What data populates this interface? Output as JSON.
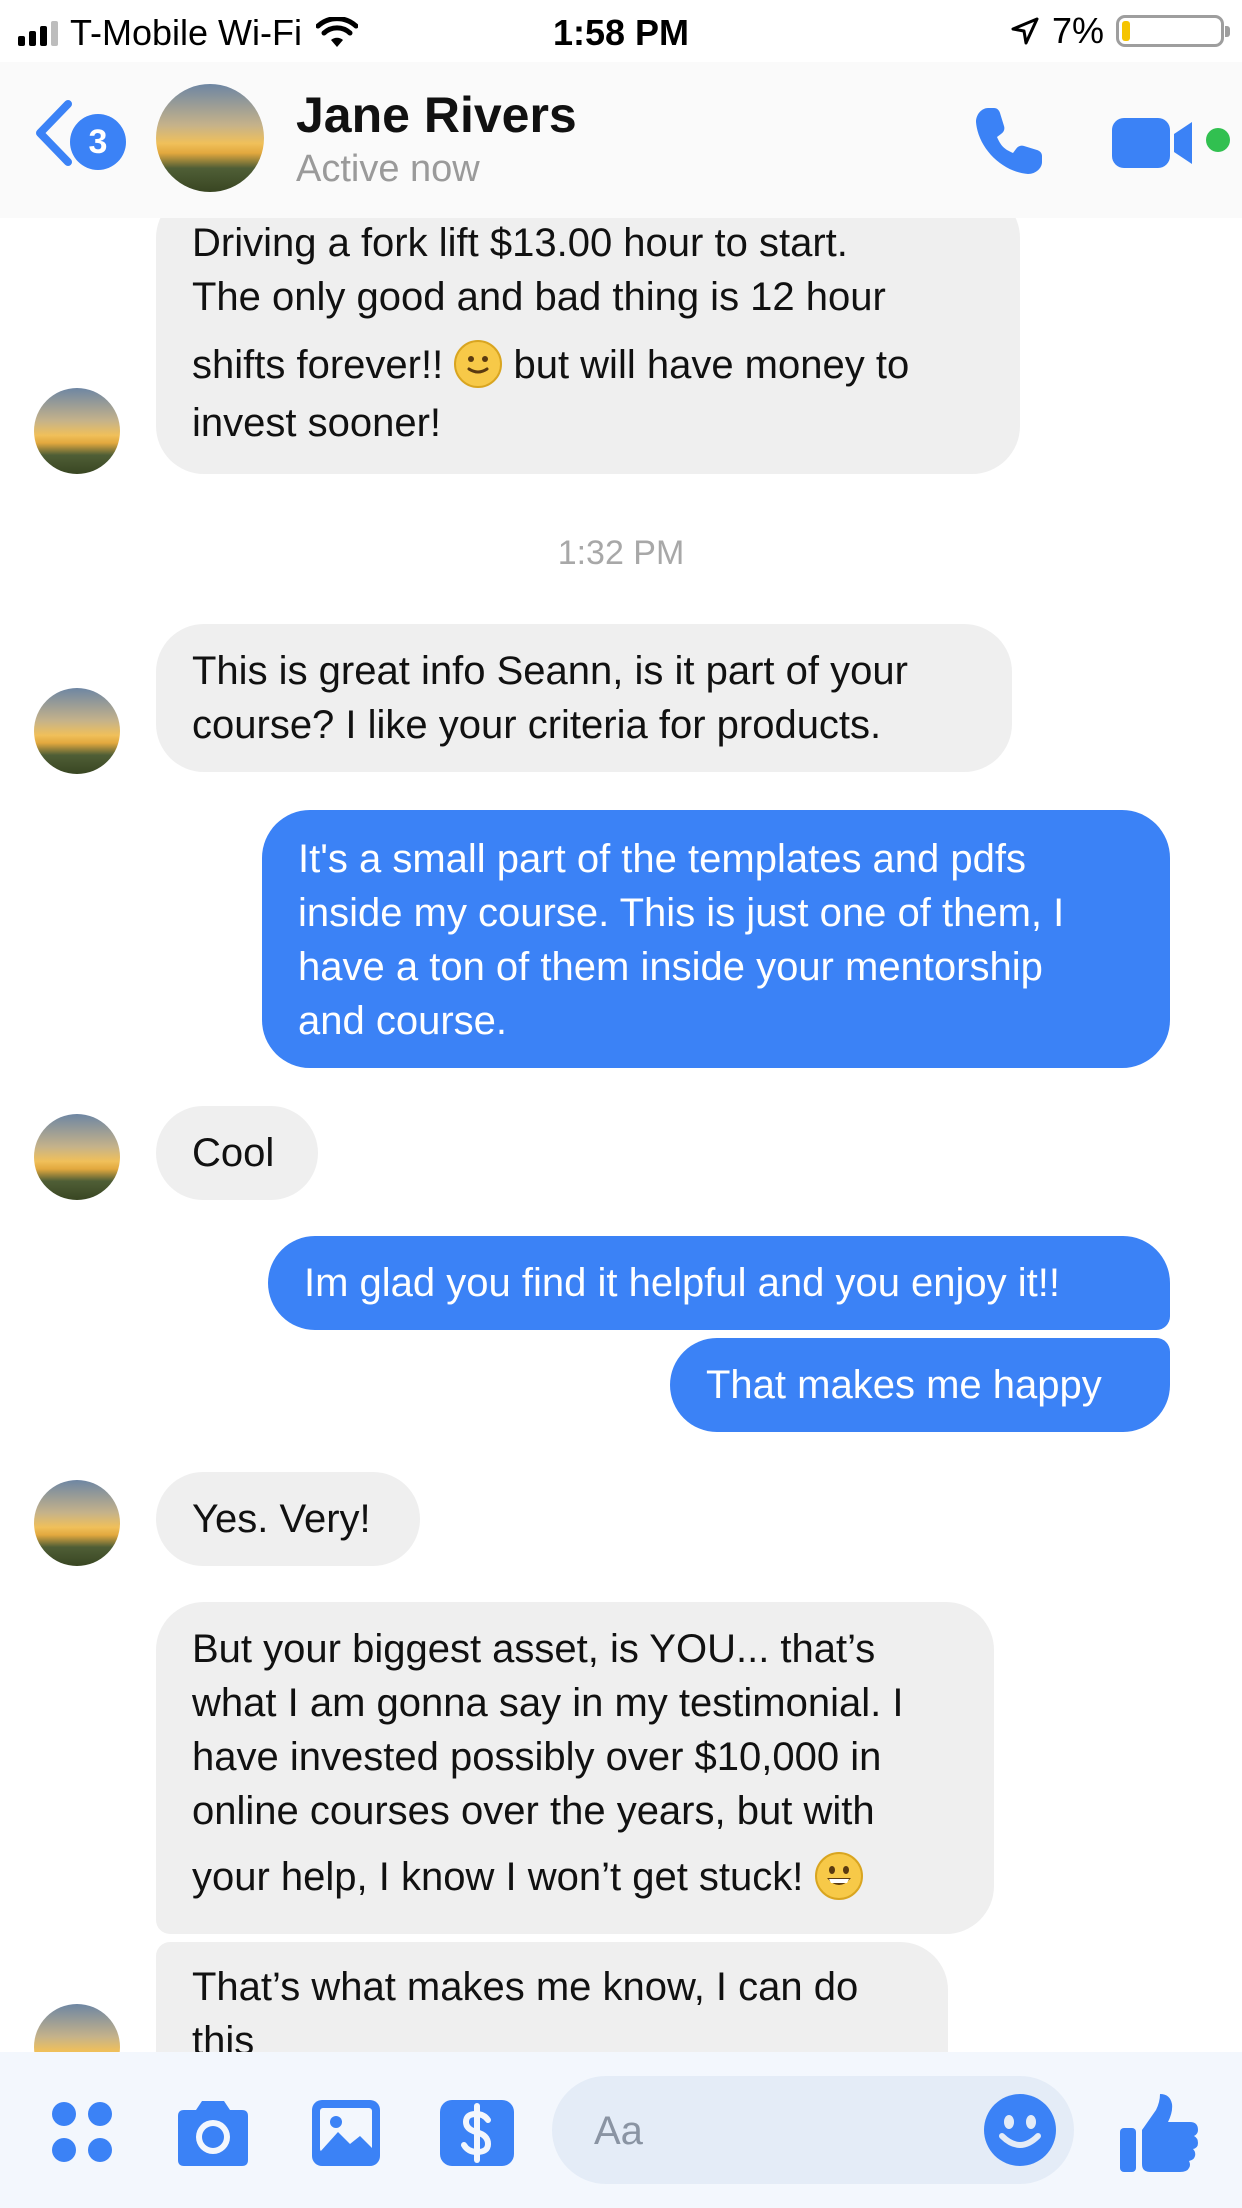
{
  "status_bar": {
    "carrier": "T-Mobile Wi-Fi",
    "time": "1:58 PM",
    "battery": "7%",
    "battery_level": 0.07,
    "icons": [
      "signal-icon",
      "wifi-icon",
      "location-arrow-icon",
      "battery-icon"
    ]
  },
  "header": {
    "unread_count": "3",
    "contact_name": "Jane Rivers",
    "status": "Active now",
    "icons": [
      "back-chevron-icon",
      "phone-icon",
      "video-camera-icon"
    ],
    "online_color": "#31c050"
  },
  "messages": {
    "m1": {
      "lines": [
        "Driving a fork lift $13.00 hour to start.",
        "The only good and bad thing is 12 hour",
        "but will have money to",
        "invest sooner!"
      ],
      "line3_prefix": "shifts forever!!"
    },
    "timestamp": "1:32 PM",
    "m2": {
      "lines": [
        "This is great info Seann, is it part of your",
        "course? I like your criteria for products."
      ]
    },
    "m3": {
      "lines": [
        "It's a small part of the templates and pdfs",
        "inside my course. This is just one of them, I",
        "have a ton of them inside your mentorship",
        "and course."
      ]
    },
    "m4": {
      "text": "Cool"
    },
    "m5": {
      "text": "Im glad you find it helpful and you enjoy it!!"
    },
    "m6": {
      "text": "That makes me happy"
    },
    "m7": {
      "text": "Yes. Very!"
    },
    "m8": {
      "lines": [
        "But your biggest asset, is YOU... that’s",
        "what I am gonna say in my testimonial. I",
        "have invested possibly over $10,000 in",
        "online courses over the years, but with",
        "your help, I know I won’t get stuck!"
      ]
    },
    "m9": {
      "lines": [
        "That’s what makes me know, I can do",
        "this"
      ]
    }
  },
  "composer": {
    "placeholder": "Aa",
    "icons": [
      "menu-dots-icon",
      "camera-icon",
      "photo-icon",
      "payment-icon",
      "emoji-icon",
      "thumbs-up-icon"
    ]
  },
  "colors": {
    "accent": "#3b82f6",
    "incoming_bubble": "#efefef",
    "outgoing_bubble": "#3b82f6"
  }
}
